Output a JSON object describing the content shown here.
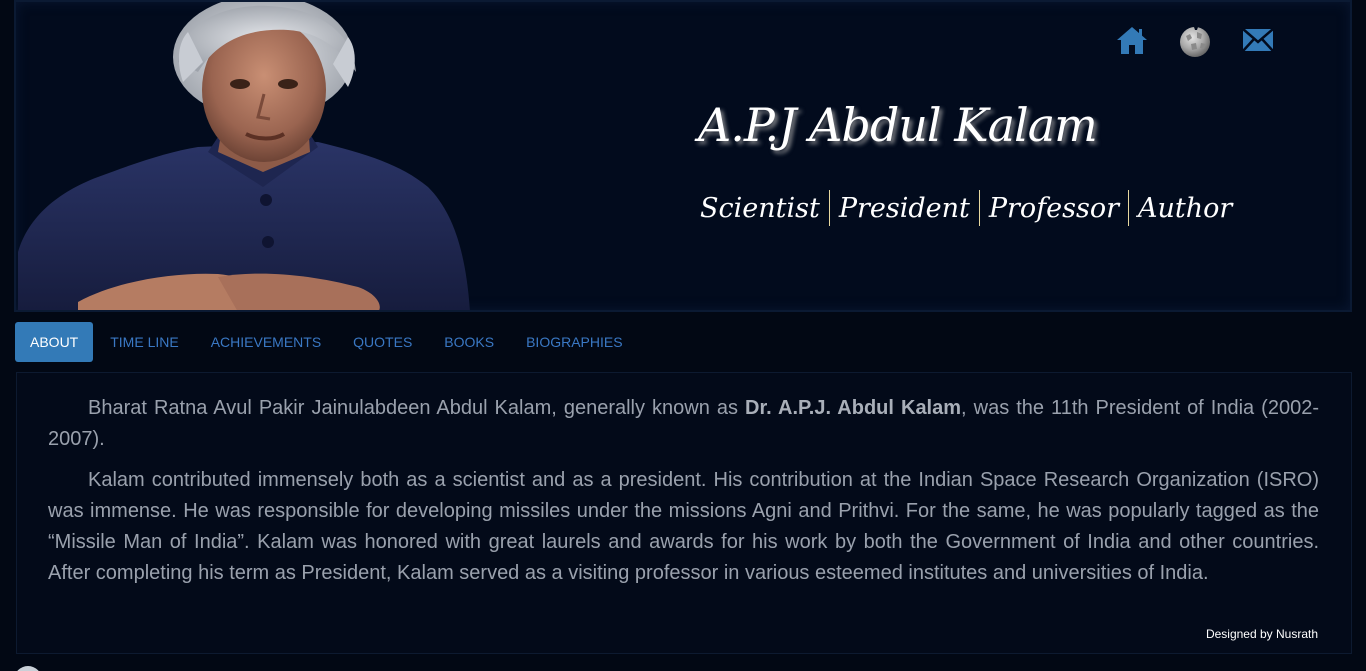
{
  "header": {
    "title": "A.P.J Abdul Kalam",
    "roles": [
      "Scientist",
      "President",
      "Professor",
      "Author"
    ],
    "icons": [
      "home-icon",
      "globe-icon",
      "mail-icon"
    ],
    "icon_color": "#337ab7"
  },
  "nav": {
    "tabs": [
      {
        "label": "ABOUT",
        "active": true
      },
      {
        "label": "TIME LINE",
        "active": false
      },
      {
        "label": "ACHIEVEMENTS",
        "active": false
      },
      {
        "label": "QUOTES",
        "active": false
      },
      {
        "label": "BOOKS",
        "active": false
      },
      {
        "label": "BIOGRAPHIES",
        "active": false
      }
    ],
    "active_color": "#337ab7",
    "link_color": "#3a78c4"
  },
  "about": {
    "para1_before": "Bharat Ratna Avul Pakir Jainulabdeen Abdul Kalam, generally known as ",
    "para1_bold": "Dr. A.P.J. Abdul Kalam",
    "para1_after": ", was the 11th President of India (2002-2007).",
    "para2": "Kalam contributed immensely both as a scientist and as a president. His contribution at the Indian Space Research Organization (ISRO) was immense. He was responsible for developing missiles under the missions Agni and Prithvi. For the same, he was popularly tagged as the “Missile Man of India”. Kalam was honored with great laurels and awards for his work by both the Government of India and other countries. After completing his term as President, Kalam served as a visiting professor in various esteemed institutes and universities of India."
  },
  "footer": {
    "credit": "Designed by Nusrath"
  }
}
